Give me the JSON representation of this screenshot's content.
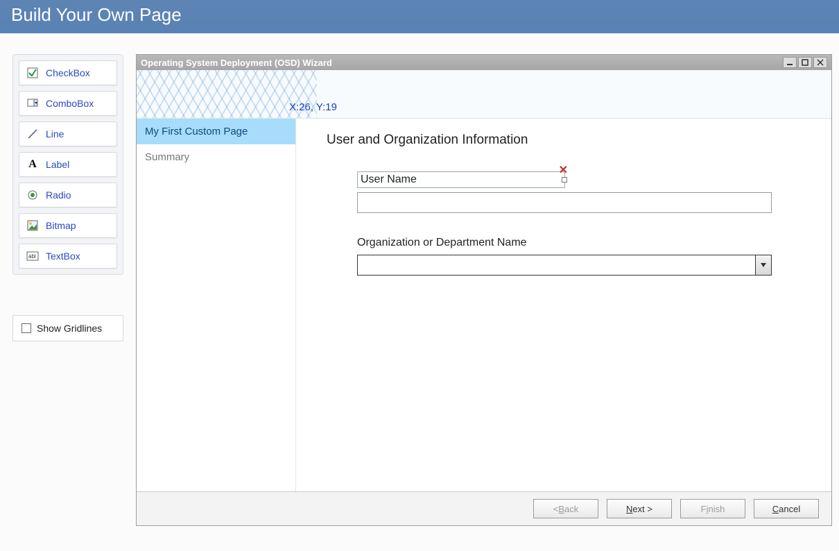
{
  "header": {
    "title": "Build Your Own Page"
  },
  "toolbox": {
    "items": [
      {
        "label": "CheckBox",
        "icon": "checkbox"
      },
      {
        "label": "ComboBox",
        "icon": "combobox"
      },
      {
        "label": "Line",
        "icon": "line"
      },
      {
        "label": "Label",
        "icon": "label"
      },
      {
        "label": "Radio",
        "icon": "radio"
      },
      {
        "label": "Bitmap",
        "icon": "bitmap"
      },
      {
        "label": "TextBox",
        "icon": "textbox"
      }
    ]
  },
  "show_gridlines": {
    "label": "Show Gridlines",
    "checked": false
  },
  "wizard": {
    "title": "Operating System Deployment (OSD) Wizard",
    "coords_text": "X:26, Y:19",
    "nav": [
      {
        "label": "My First Custom Page",
        "active": true
      },
      {
        "label": "Summary",
        "active": false
      }
    ],
    "page": {
      "heading": "User and Organization Information",
      "user_name_label": "User Name",
      "user_name_value": "",
      "org_label": "Organization or Department Name",
      "org_value": ""
    },
    "buttons": {
      "back": "< Back",
      "next": "Next >",
      "finish": "Finish",
      "cancel": "Cancel"
    }
  }
}
